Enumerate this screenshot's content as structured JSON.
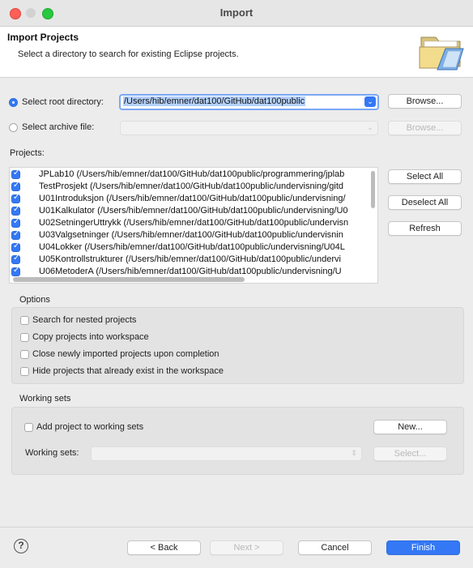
{
  "window": {
    "title": "Import"
  },
  "header": {
    "title": "Import Projects",
    "subtitle": "Select a directory to search for existing Eclipse projects.",
    "icon": "folder-icon"
  },
  "source": {
    "root_label": "Select root directory:",
    "root_value": "/Users/hib/emner/dat100/GitHub/dat100public",
    "archive_label": "Select archive file:",
    "archive_value": "",
    "browse_label": "Browse..."
  },
  "projects": {
    "label": "Projects:",
    "items": [
      {
        "text": "JPLab10 (/Users/hib/emner/dat100/GitHub/dat100public/programmering/jplab",
        "checked": true
      },
      {
        "text": "TestProsjekt (/Users/hib/emner/dat100/GitHub/dat100public/undervisning/gitd",
        "checked": true
      },
      {
        "text": "U01Introduksjon (/Users/hib/emner/dat100/GitHub/dat100public/undervisning/",
        "checked": true
      },
      {
        "text": "U01Kalkulator (/Users/hib/emner/dat100/GitHub/dat100public/undervisning/U0",
        "checked": true
      },
      {
        "text": "U02SetningerUttrykk (/Users/hib/emner/dat100/GitHub/dat100public/undervisn",
        "checked": true
      },
      {
        "text": "U03Valgsetninger (/Users/hib/emner/dat100/GitHub/dat100public/undervisnin",
        "checked": true
      },
      {
        "text": "U04Lokker (/Users/hib/emner/dat100/GitHub/dat100public/undervisning/U04L",
        "checked": true
      },
      {
        "text": "U05Kontrollstrukturer (/Users/hib/emner/dat100/GitHub/dat100public/undervi",
        "checked": true
      },
      {
        "text": "U06MetoderA (/Users/hib/emner/dat100/GitHub/dat100public/undervisning/U",
        "checked": true
      }
    ],
    "select_all": "Select All",
    "deselect_all": "Deselect All",
    "refresh": "Refresh"
  },
  "options": {
    "label": "Options",
    "items": [
      "Search for nested projects",
      "Copy projects into workspace",
      "Close newly imported projects upon completion",
      "Hide projects that already exist in the workspace"
    ]
  },
  "working_sets": {
    "label": "Working sets",
    "add_label": "Add project to working sets",
    "new_button": "New...",
    "sets_label": "Working sets:",
    "sets_value": "",
    "select_button": "Select..."
  },
  "footer": {
    "help": "?",
    "back": "< Back",
    "next": "Next >",
    "cancel": "Cancel",
    "finish": "Finish"
  },
  "colors": {
    "accent": "#3478f6"
  }
}
